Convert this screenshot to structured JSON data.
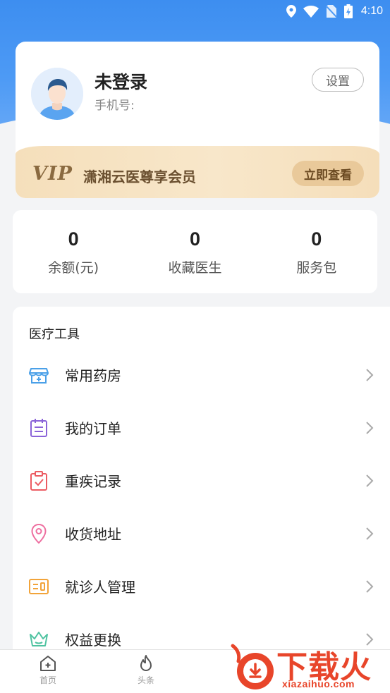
{
  "status_bar": {
    "time": "4:10",
    "icons": [
      "location-icon",
      "wifi-icon",
      "no-sim-icon",
      "battery-charging-icon"
    ]
  },
  "colors": {
    "header_blue": "#3d8ef0",
    "vip_gold": "#f5dfbb",
    "vip_button": "#e9c99a",
    "watermark_red": "#e8452a"
  },
  "profile": {
    "name": "未登录",
    "phone_label": "手机号:",
    "settings_label": "设置",
    "avatar_icon": "user-avatar-icon"
  },
  "vip": {
    "logo": "VIP",
    "text": "潇湘云医尊享会员",
    "button": "立即查看"
  },
  "stats": [
    {
      "value": "0",
      "label": "余额(元)"
    },
    {
      "value": "0",
      "label": "收藏医生"
    },
    {
      "value": "0",
      "label": "服务包"
    }
  ],
  "tools": {
    "title": "医疗工具",
    "items": [
      {
        "label": "常用药房",
        "icon": "pharmacy-icon"
      },
      {
        "label": "我的订单",
        "icon": "order-icon"
      },
      {
        "label": "重疾记录",
        "icon": "clipboard-check-icon"
      },
      {
        "label": "收货地址",
        "icon": "location-pin-icon"
      },
      {
        "label": "就诊人管理",
        "icon": "patient-card-icon"
      },
      {
        "label": "权益更换",
        "icon": "crown-icon"
      }
    ]
  },
  "tabbar": {
    "tabs": [
      {
        "label": "首页",
        "icon": "home-icon"
      },
      {
        "label": "头条",
        "icon": "flame-icon"
      }
    ]
  },
  "watermark": {
    "text": "下载火",
    "sub": "xiazaihuo.com"
  }
}
